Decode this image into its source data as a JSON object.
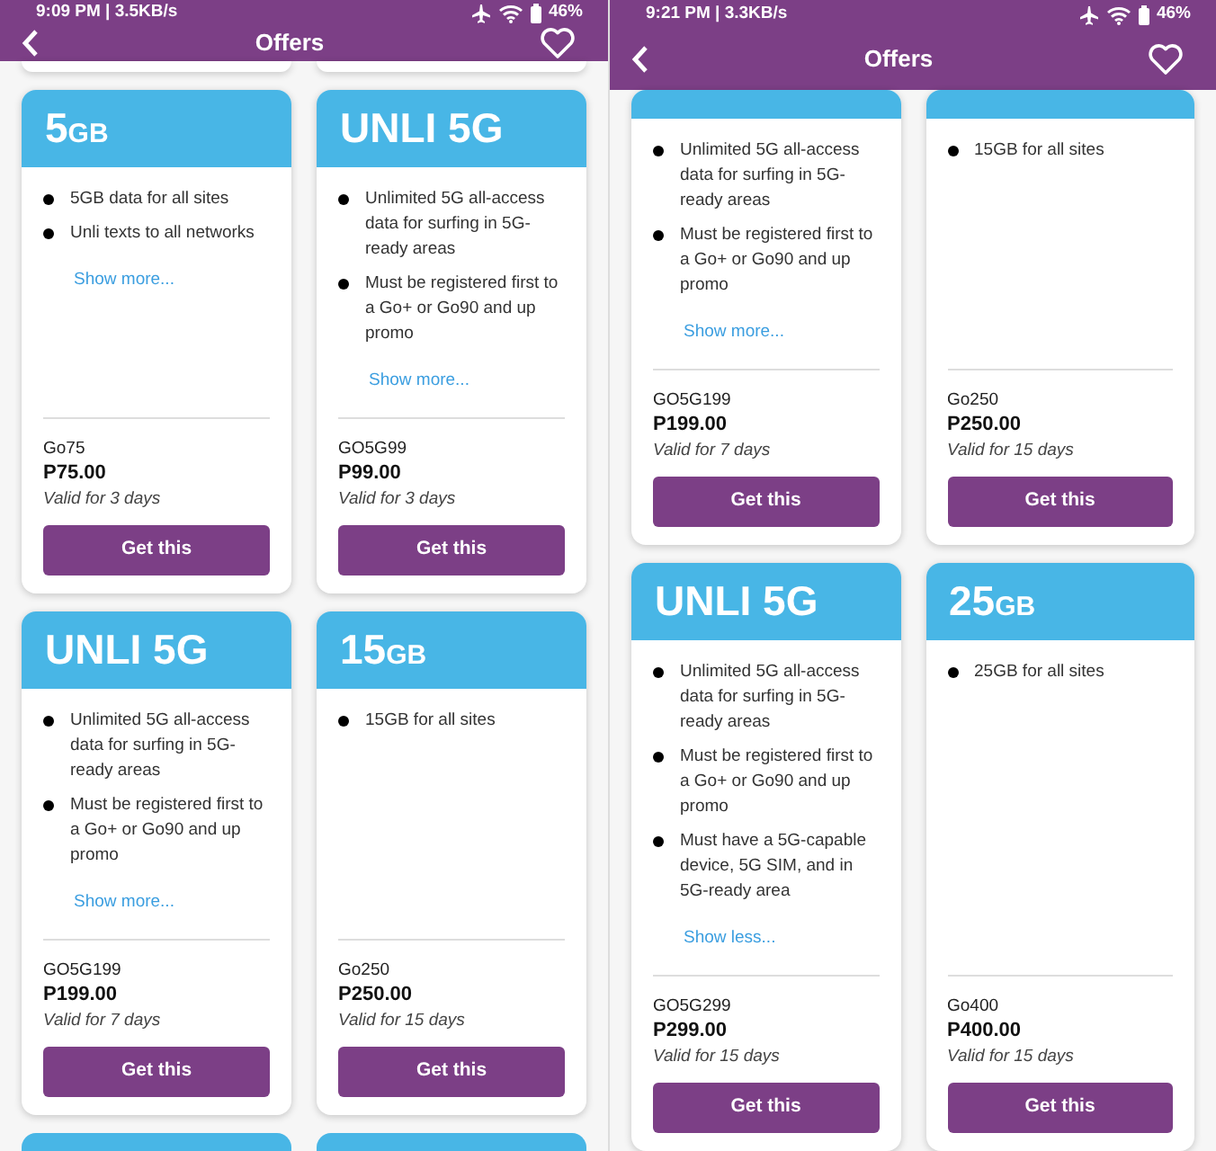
{
  "screens": [
    {
      "status_bar": {
        "time": "9:09 PM | 3.5KB/s",
        "battery": "46%"
      },
      "app_bar": {
        "title": "Offers"
      },
      "rows": [
        {
          "kind": "peek_bottom",
          "cards": [
            {
              "kind": "stub"
            },
            {
              "kind": "stub"
            }
          ]
        },
        {
          "kind": "full",
          "cards": [
            {
              "kind": "full",
              "title": "5",
              "unit": "GB",
              "features": [
                "5GB data for all sites",
                "Unli texts to all networks"
              ],
              "toggle": "Show more...",
              "code": "Go75",
              "price": "P75.00",
              "validity": "Valid for 3 days",
              "button": "Get this"
            },
            {
              "kind": "full",
              "title": "UNLI 5G",
              "features": [
                "Unlimited 5G all-access data for surfing in 5G-ready areas",
                "Must be registered first to a Go+ or Go90 and up promo"
              ],
              "toggle": "Show more...",
              "code": "GO5G99",
              "price": "P99.00",
              "validity": "Valid for 3 days",
              "button": "Get this"
            }
          ]
        },
        {
          "kind": "full",
          "cards": [
            {
              "kind": "full",
              "title": "UNLI 5G",
              "features": [
                "Unlimited 5G all-access data for surfing in 5G-ready areas",
                "Must be registered first to a Go+ or Go90 and up promo"
              ],
              "toggle": "Show more...",
              "code": "GO5G199",
              "price": "P199.00",
              "validity": "Valid for 7 days",
              "button": "Get this"
            },
            {
              "kind": "full",
              "title": "15",
              "unit": "GB",
              "features": [
                "15GB for all sites"
              ],
              "code": "Go250",
              "price": "P250.00",
              "validity": "Valid for 15 days",
              "button": "Get this"
            }
          ]
        },
        {
          "kind": "peek_top",
          "cards": [
            {
              "kind": "stub"
            },
            {
              "kind": "stub"
            }
          ]
        }
      ]
    },
    {
      "status_bar": {
        "time": "9:21 PM | 3.3KB/s",
        "battery": "46%"
      },
      "app_bar": {
        "title": "Offers"
      },
      "rows": [
        {
          "kind": "cut_top",
          "cards": [
            {
              "kind": "cut",
              "features": [
                "Unlimited 5G all-access data for surfing in 5G-ready areas",
                "Must be registered first to a Go+ or Go90 and up promo"
              ],
              "toggle": "Show more...",
              "code": "GO5G199",
              "price": "P199.00",
              "validity": "Valid for 7 days",
              "button": "Get this"
            },
            {
              "kind": "cut",
              "features": [
                "15GB for all sites"
              ],
              "code": "Go250",
              "price": "P250.00",
              "validity": "Valid for 15 days",
              "button": "Get this"
            }
          ]
        },
        {
          "kind": "full",
          "cards": [
            {
              "kind": "full",
              "title": "UNLI 5G",
              "features": [
                "Unlimited 5G all-access data for surfing in 5G-ready areas",
                "Must be registered first to a Go+ or Go90 and up promo",
                "Must have a 5G-capable device, 5G SIM, and in 5G-ready area"
              ],
              "toggle": "Show less...",
              "code": "GO5G299",
              "price": "P299.00",
              "validity": "Valid for 15 days",
              "button": "Get this"
            },
            {
              "kind": "full",
              "title": "25",
              "unit": "GB",
              "features": [
                "25GB for all sites"
              ],
              "code": "Go400",
              "price": "P400.00",
              "validity": "Valid for 15 days",
              "button": "Get this"
            }
          ]
        }
      ]
    }
  ]
}
